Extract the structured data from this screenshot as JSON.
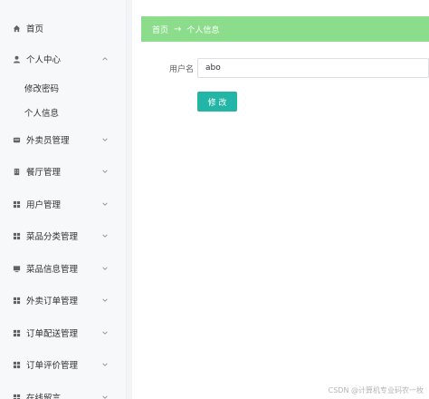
{
  "sidebar": {
    "items": [
      {
        "label": "首页",
        "icon": "home-icon",
        "expandable": false
      },
      {
        "label": "个人中心",
        "icon": "user-icon",
        "expandable": true,
        "expanded": true,
        "children": [
          {
            "label": "修改密码"
          },
          {
            "label": "个人信息"
          }
        ]
      },
      {
        "label": "外卖员管理",
        "icon": "bike-icon",
        "expandable": true
      },
      {
        "label": "餐厅管理",
        "icon": "building-icon",
        "expandable": true
      },
      {
        "label": "用户管理",
        "icon": "grid-icon",
        "expandable": true
      },
      {
        "label": "菜品分类管理",
        "icon": "grid-icon",
        "expandable": true
      },
      {
        "label": "菜品信息管理",
        "icon": "monitor-icon",
        "expandable": true
      },
      {
        "label": "外卖订单管理",
        "icon": "grid-icon",
        "expandable": true
      },
      {
        "label": "订单配送管理",
        "icon": "grid-icon",
        "expandable": true
      },
      {
        "label": "订单评价管理",
        "icon": "grid-icon",
        "expandable": true
      },
      {
        "label": "在线留言",
        "icon": "grid-icon",
        "expandable": true
      }
    ]
  },
  "breadcrumb": {
    "home": "首页",
    "separator": "→",
    "current": "个人信息"
  },
  "form": {
    "username_label": "用户名",
    "username_value": "abo",
    "submit_label": "修 改"
  },
  "watermark": "CSDN @计算机专业码农一枚",
  "colors": {
    "breadcrumb_bg": "#8bdc8b",
    "button_bg": "#23b5a6",
    "sidebar_bg": "#f7f8fa"
  }
}
